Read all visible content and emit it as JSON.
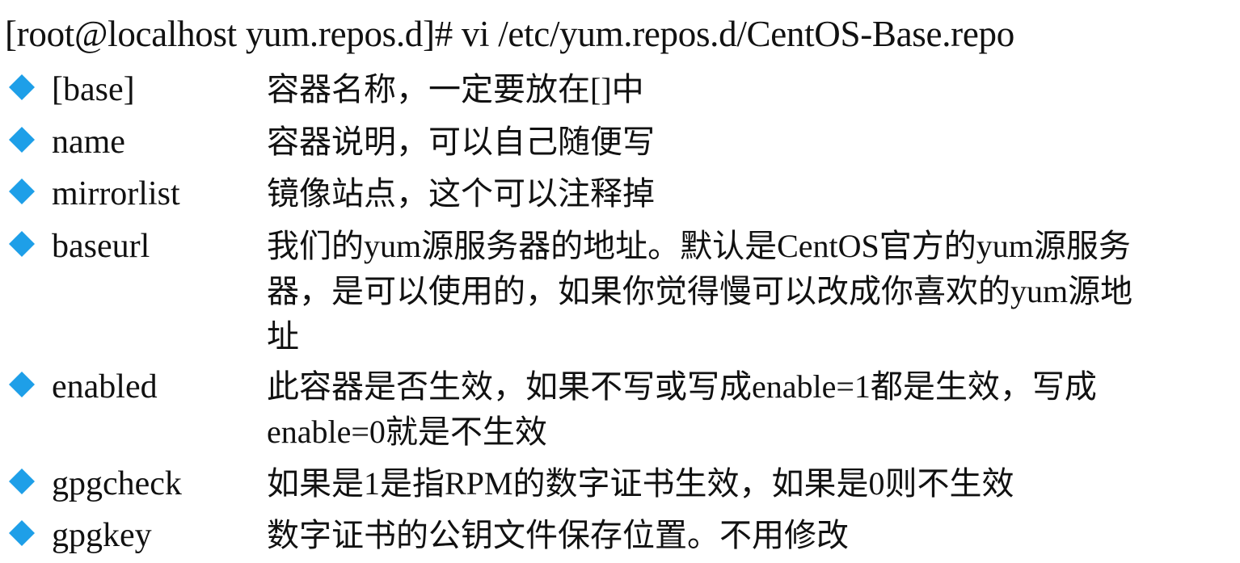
{
  "command_line": "[root@localhost yum.repos.d]# vi /etc/yum.repos.d/CentOS-Base.repo",
  "bullet_icon": "blue-diamond-icon",
  "bullet_color": "#1E9FE8",
  "items": [
    {
      "term": "[base]",
      "desc": "容器名称，一定要放在[]中"
    },
    {
      "term": "name",
      "desc": "容器说明，可以自己随便写"
    },
    {
      "term": "mirrorlist",
      "desc": "镜像站点，这个可以注释掉"
    },
    {
      "term": "baseurl",
      "desc": "我们的yum源服务器的地址。默认是CentOS官方的yum源服务\n器，是可以使用的，如果你觉得慢可以改成你喜欢的yum源地\n址"
    },
    {
      "term": "enabled",
      "desc": "此容器是否生效，如果不写或写成enable=1都是生效，写成\nenable=0就是不生效"
    },
    {
      "term": "gpgcheck",
      "desc": "如果是1是指RPM的数字证书生效，如果是0则不生效"
    },
    {
      "term": "gpgkey",
      "desc": "数字证书的公钥文件保存位置。不用修改"
    }
  ]
}
